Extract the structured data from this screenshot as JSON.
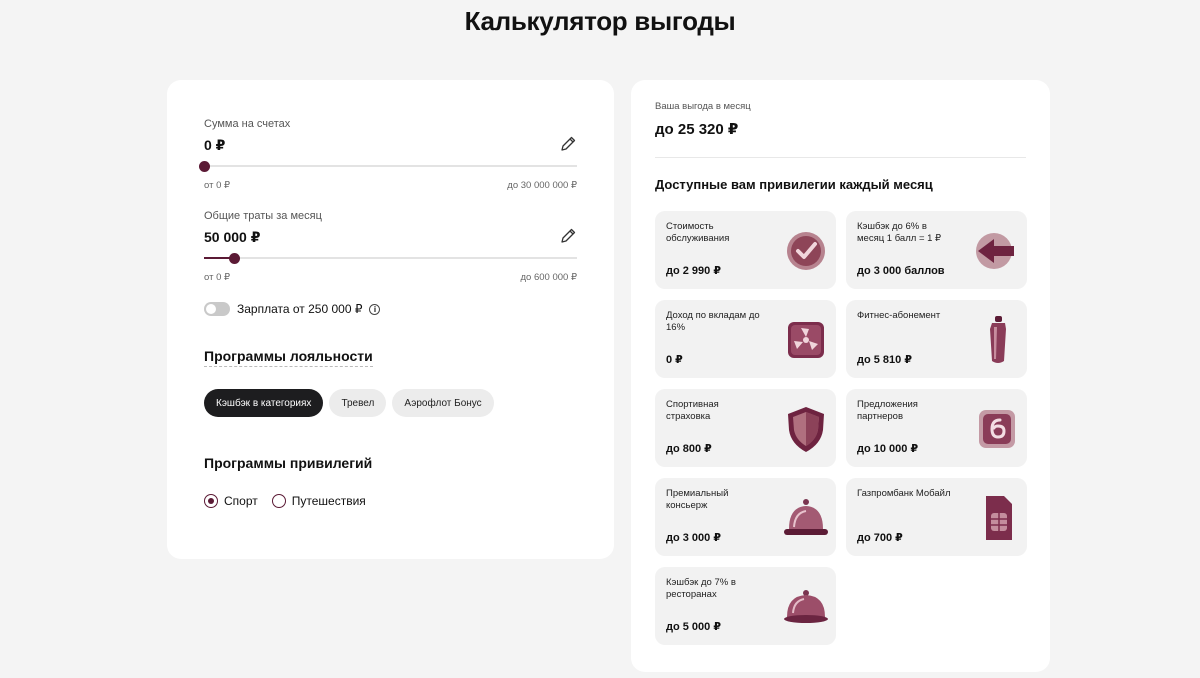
{
  "page": {
    "title": "Калькулятор выгоды"
  },
  "colors": {
    "accent": "#5b1a35",
    "chip_active": "#1d1d1f",
    "background": "#f4f4f4"
  },
  "calculator": {
    "balance": {
      "label": "Сумма на счетах",
      "value": "0 ₽",
      "min": "от 0 ₽",
      "max": "до 30 000 000 ₽",
      "fraction": 0.0,
      "icon": "pencil-icon"
    },
    "spend": {
      "label": "Общие траты за месяц",
      "value": "50 000 ₽",
      "min": "от 0 ₽",
      "max": "до 600 000 ₽",
      "fraction": 0.083,
      "icon": "pencil-icon"
    },
    "salary_toggle": {
      "label": "Зарплата от 250 000 ₽",
      "checked": false,
      "info_icon": "i"
    },
    "loyalty": {
      "heading": "Программы лояльности",
      "chips": [
        {
          "label": "Кэшбэк в категориях",
          "active": true
        },
        {
          "label": "Тревел",
          "active": false
        },
        {
          "label": "Аэрофлот Бонус",
          "active": false
        }
      ]
    },
    "privileges": {
      "heading": "Программы привилегий",
      "options": [
        {
          "label": "Спорт",
          "selected": true
        },
        {
          "label": "Путешествия",
          "selected": false
        }
      ]
    }
  },
  "summary": {
    "benefit_label": "Ваша выгода в месяц",
    "benefit_value": "до 25 320 ₽",
    "privileges_heading": "Доступные вам привилегии каждый месяц",
    "tiles": [
      {
        "name": "Стоимость обслуживания",
        "value": "до 2 990 ₽",
        "icon": "checkmark-badge-icon"
      },
      {
        "name": "Кэшбэк до 6% в месяц 1 балл = 1 ₽",
        "value": "до 3 000 баллов",
        "icon": "cashback-arrow-icon"
      },
      {
        "name": "Доход по вкладам до 16%",
        "value": "0 ₽",
        "icon": "fan-icon"
      },
      {
        "name": "Фитнес-абонемент",
        "value": "до 5 810 ₽",
        "icon": "water-bottle-icon"
      },
      {
        "name": "Спортивная страховка",
        "value": "до 800 ₽",
        "icon": "shield-icon"
      },
      {
        "name": "Предложения партнеров",
        "value": "до 10 000 ₽",
        "icon": "partner-badge-icon"
      },
      {
        "name": "Премиальный консьерж",
        "value": "до 3 000 ₽",
        "icon": "service-bell-icon"
      },
      {
        "name": "Газпромбанк Мобайл",
        "value": "до 700 ₽",
        "icon": "sim-card-icon"
      },
      {
        "name": "Кэшбэк до 7% в ресторанах",
        "value": "до 5 000 ₽",
        "icon": "cloche-icon"
      }
    ]
  }
}
